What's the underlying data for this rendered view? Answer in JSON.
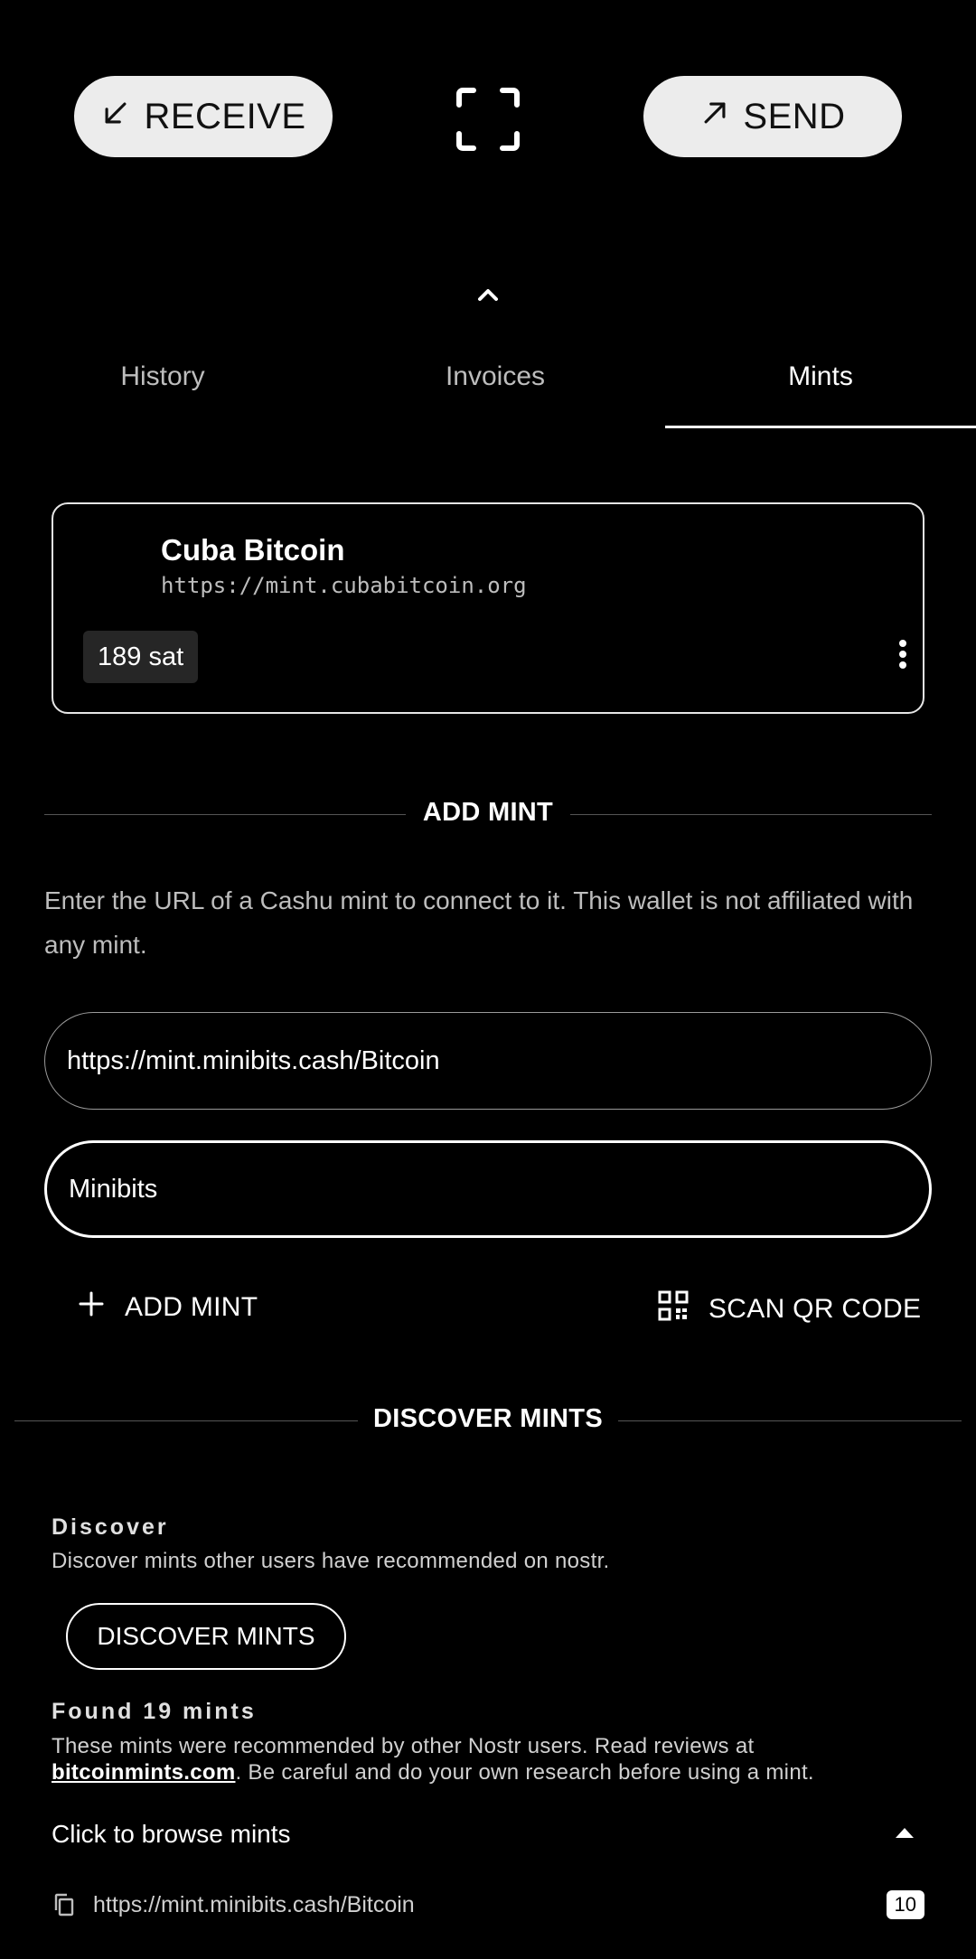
{
  "actions": {
    "receive_label": "RECEIVE",
    "send_label": "SEND"
  },
  "tabs": [
    {
      "label": "History"
    },
    {
      "label": "Invoices"
    },
    {
      "label": "Mints"
    }
  ],
  "mint_card": {
    "name": "Cuba Bitcoin",
    "url": "https://mint.cubabitcoin.org",
    "balance": "189 sat"
  },
  "add_mint": {
    "heading": "ADD MINT",
    "description": "Enter the URL of a Cashu mint to connect to it. This wallet is not affiliated with any mint.",
    "url_value": "https://mint.minibits.cash/Bitcoin",
    "name_value": "Minibits",
    "add_button": "ADD MINT",
    "scan_button": "SCAN QR CODE"
  },
  "discover": {
    "heading": "DISCOVER MINTS",
    "subheading": "Discover",
    "description": "Discover mints other users have recommended on nostr.",
    "button": "DISCOVER MINTS",
    "found_title": "Found 19 mints",
    "found_text_before": "These mints were recommended by other Nostr users. Read reviews at ",
    "found_link": "bitcoinmints.com",
    "found_text_after": ". Be careful and do your own research before using a mint.",
    "browse_label": "Click to browse mints",
    "list": [
      {
        "url": "https://mint.minibits.cash/Bitcoin",
        "count": "10"
      }
    ]
  }
}
